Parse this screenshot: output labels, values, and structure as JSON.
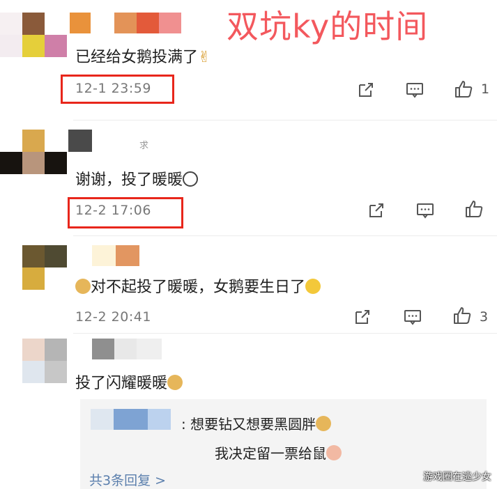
{
  "overlay_title": "双坑ky的时间",
  "comments": [
    {
      "text": "已经给女鹅投满了",
      "emoji_after": "✌",
      "time": "12-1 23:59",
      "like_count": "1"
    },
    {
      "text": "谢谢，投了暖暖",
      "time": "12-2 17:06",
      "like_count": "",
      "name_fragment": "求"
    },
    {
      "text": "对不起投了暖暖，女鹅要生日了",
      "time": "12-2 20:41",
      "like_count": "3"
    },
    {
      "text": "投了闪耀暖暖",
      "time": ""
    }
  ],
  "reply": {
    "line1": ": 想要钻又想要黑圆胖",
    "line2": "我决定留一票给鼠",
    "more_label": "共3条回复 >"
  },
  "watermark": "游戏圈在逃少女",
  "icons": {
    "share": "share-icon",
    "comment": "comment-icon",
    "like": "thumbs-up-icon"
  },
  "colors": {
    "highlight_red": "#e8261b",
    "title_red": "#f3585d",
    "reply_link": "#5b7fad"
  }
}
